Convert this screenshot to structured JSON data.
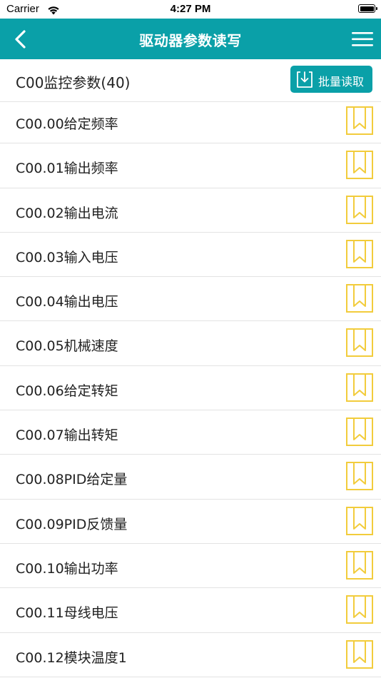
{
  "status_bar": {
    "carrier": "Carrier",
    "time": "4:27 PM"
  },
  "nav": {
    "title": "驱动器参数读写",
    "back_icon": "chevron-left-icon",
    "menu_icon": "hamburger-menu-icon"
  },
  "section": {
    "title": "C00监控参数(40)",
    "batch_read_label": "批量读取",
    "batch_read_icon": "download-icon"
  },
  "params": [
    {
      "label": "C00.00给定频率"
    },
    {
      "label": "C00.01输出频率"
    },
    {
      "label": "C00.02输出电流"
    },
    {
      "label": "C00.03输入电压"
    },
    {
      "label": "C00.04输出电压"
    },
    {
      "label": "C00.05机械速度"
    },
    {
      "label": "C00.06给定转矩"
    },
    {
      "label": "C00.07输出转矩"
    },
    {
      "label": "C00.08PID给定量"
    },
    {
      "label": "C00.09PID反馈量"
    },
    {
      "label": "C00.10输出功率"
    },
    {
      "label": "C00.11母线电压"
    },
    {
      "label": "C00.12模块温度1"
    }
  ],
  "colors": {
    "accent": "#0aa0a8",
    "bookmark": "#f2cc3c",
    "divider": "#e3e3e3"
  }
}
